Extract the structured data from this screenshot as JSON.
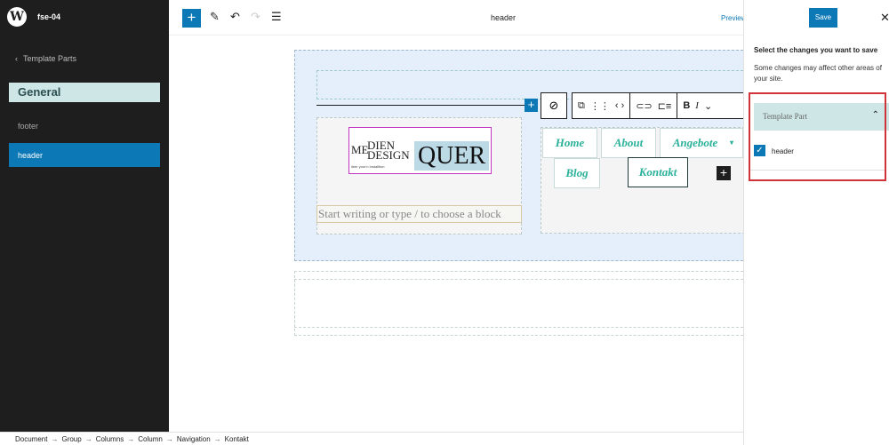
{
  "sidebar": {
    "site_name": "fse-04",
    "back_label": "Template Parts",
    "section_title": "General",
    "items": [
      {
        "label": "footer",
        "active": false
      },
      {
        "label": "header",
        "active": true
      }
    ]
  },
  "topbar": {
    "document_title": "header",
    "preview_label": "Preview"
  },
  "canvas": {
    "logo": {
      "part1": "ME",
      "part2": "DIEN",
      "part3": "DESIGN",
      "part4": "QUER",
      "sub": "lieer your'n Installtion"
    },
    "paragraph_placeholder": "Start writing or type / to choose a block",
    "nav_items": [
      "Home",
      "About",
      "Angebote",
      "Blog",
      "Kontakt"
    ],
    "nav_dropdown_glyph": "▾"
  },
  "block_toolbar": {
    "bold": "B",
    "italic": "I"
  },
  "panel": {
    "save_label": "Save",
    "heading": "Select the changes you want to save",
    "note": "Some changes may affect other areas of your site.",
    "group_title": "Template Part",
    "checkbox_label": "header",
    "checkbox_checked": true
  },
  "breadcrumb": [
    "Document",
    "Group",
    "Columns",
    "Column",
    "Navigation",
    "Kontakt"
  ],
  "colors": {
    "accent": "#0c78b6",
    "sidebar_bg": "#1e1e1e",
    "nav_text": "#2ab19a",
    "highlight_red": "#d13438"
  }
}
